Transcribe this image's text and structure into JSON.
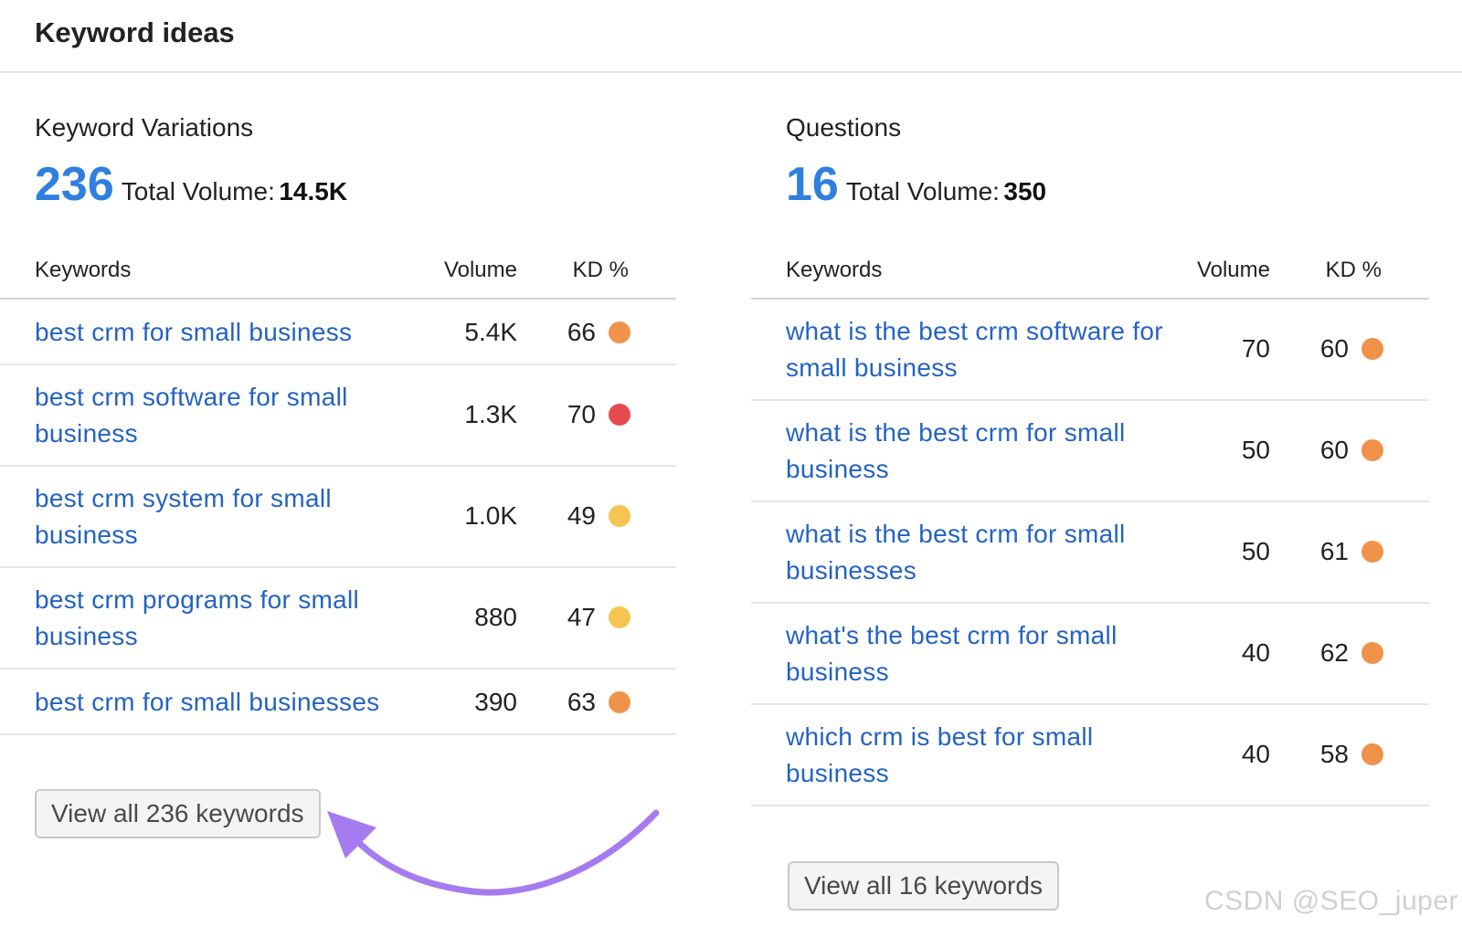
{
  "page_title": "Keyword ideas",
  "left_panel": {
    "title": "Keyword Variations",
    "count": "236",
    "total_volume_label": "Total Volume:",
    "total_volume_value": "14.5K",
    "headers": {
      "keywords": "Keywords",
      "volume": "Volume",
      "kd": "KD %"
    },
    "rows": [
      {
        "keyword": "best crm for small business",
        "volume": "5.4K",
        "kd": "66",
        "kd_color": "#f0924a"
      },
      {
        "keyword": "best crm software for small business",
        "volume": "1.3K",
        "kd": "70",
        "kd_color": "#e84b4f"
      },
      {
        "keyword": "best crm system for small business",
        "volume": "1.0K",
        "kd": "49",
        "kd_color": "#f5c451"
      },
      {
        "keyword": "best crm programs for small business",
        "volume": "880",
        "kd": "47",
        "kd_color": "#f5c451"
      },
      {
        "keyword": "best crm for small businesses",
        "volume": "390",
        "kd": "63",
        "kd_color": "#f0924a"
      }
    ],
    "view_all_label": "View all 236 keywords"
  },
  "right_panel": {
    "title": "Questions",
    "count": "16",
    "total_volume_label": "Total Volume:",
    "total_volume_value": "350",
    "headers": {
      "keywords": "Keywords",
      "volume": "Volume",
      "kd": "KD %"
    },
    "rows": [
      {
        "keyword": "what is the best crm software for small business",
        "volume": "70",
        "kd": "60",
        "kd_color": "#f0924a"
      },
      {
        "keyword": "what is the best crm for small business",
        "volume": "50",
        "kd": "60",
        "kd_color": "#f0924a"
      },
      {
        "keyword": "what is the best crm for small businesses",
        "volume": "50",
        "kd": "61",
        "kd_color": "#f0924a"
      },
      {
        "keyword": "what's the best crm for small business",
        "volume": "40",
        "kd": "62",
        "kd_color": "#f0924a"
      },
      {
        "keyword": "which crm is best for small business",
        "volume": "40",
        "kd": "58",
        "kd_color": "#f0924a"
      }
    ],
    "view_all_label": "View all 16 keywords"
  },
  "annotation_arrow_color": "#a77bf0",
  "watermark": "CSDN @SEO_juper"
}
